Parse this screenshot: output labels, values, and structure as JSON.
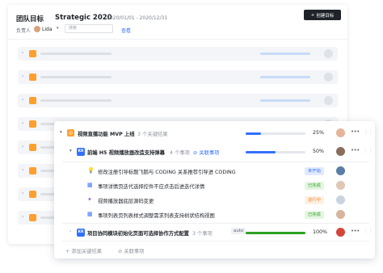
{
  "back_window": {
    "title": "团队目标",
    "plan_name": "Strategic 2020",
    "date_range": "2020/01/01 - 2020/12/31",
    "create_button": "创建目标",
    "owner_label": "负责人",
    "owner_name": "Lida",
    "search_placeholder": "搜索",
    "view_link": "查看"
  },
  "objective": {
    "title": "视频直播功能 MVP 上线",
    "kr_count": "3 个关键结果",
    "progress": 25,
    "progress_label": "25%",
    "progress_color": "#3370ff"
  },
  "key_results": [
    {
      "badge": "KR",
      "title": "前端 H5 视频播放器改造支持弹幕",
      "task_count": "4 个事项",
      "link_label": "关联事项",
      "progress": 50,
      "progress_label": "50%",
      "progress_color": "#3370ff"
    },
    {
      "badge": "KR",
      "title": "项目协同模块初始化页面可选择协作方式配置",
      "task_count": "3 个事项",
      "auto_label": "auto",
      "progress": 100,
      "progress_label": "100%",
      "progress_color": "#2ea121"
    }
  ],
  "tasks": [
    {
      "icon": "lightbulb-icon",
      "title": "修改注册引导标题飞鹅与 CODING 关系推荐引导进 CODING",
      "status": "未开始",
      "status_color": "#3370ff",
      "status_bg": "#e1eaff"
    },
    {
      "icon": "grid-icon",
      "title": "事项详情页迭代选择控件不应点击后进迭代详情",
      "status": "已完成",
      "status_color": "#2ea121",
      "status_bg": "#e4f6e1"
    },
    {
      "icon": "sparkle-icon",
      "title": "视频播放器底层源码变更",
      "status": "进行中",
      "status_color": "#f07f1b",
      "status_bg": "#fef0e1"
    },
    {
      "icon": "grid-icon",
      "title": "事项列表页列表样式调整需求列表支持树状结构视图",
      "status": "已完成",
      "status_color": "#2ea121",
      "status_bg": "#e4f6e1"
    }
  ],
  "footer": {
    "add_kr": "添加关键结果",
    "link_tasks": "关联事项"
  }
}
